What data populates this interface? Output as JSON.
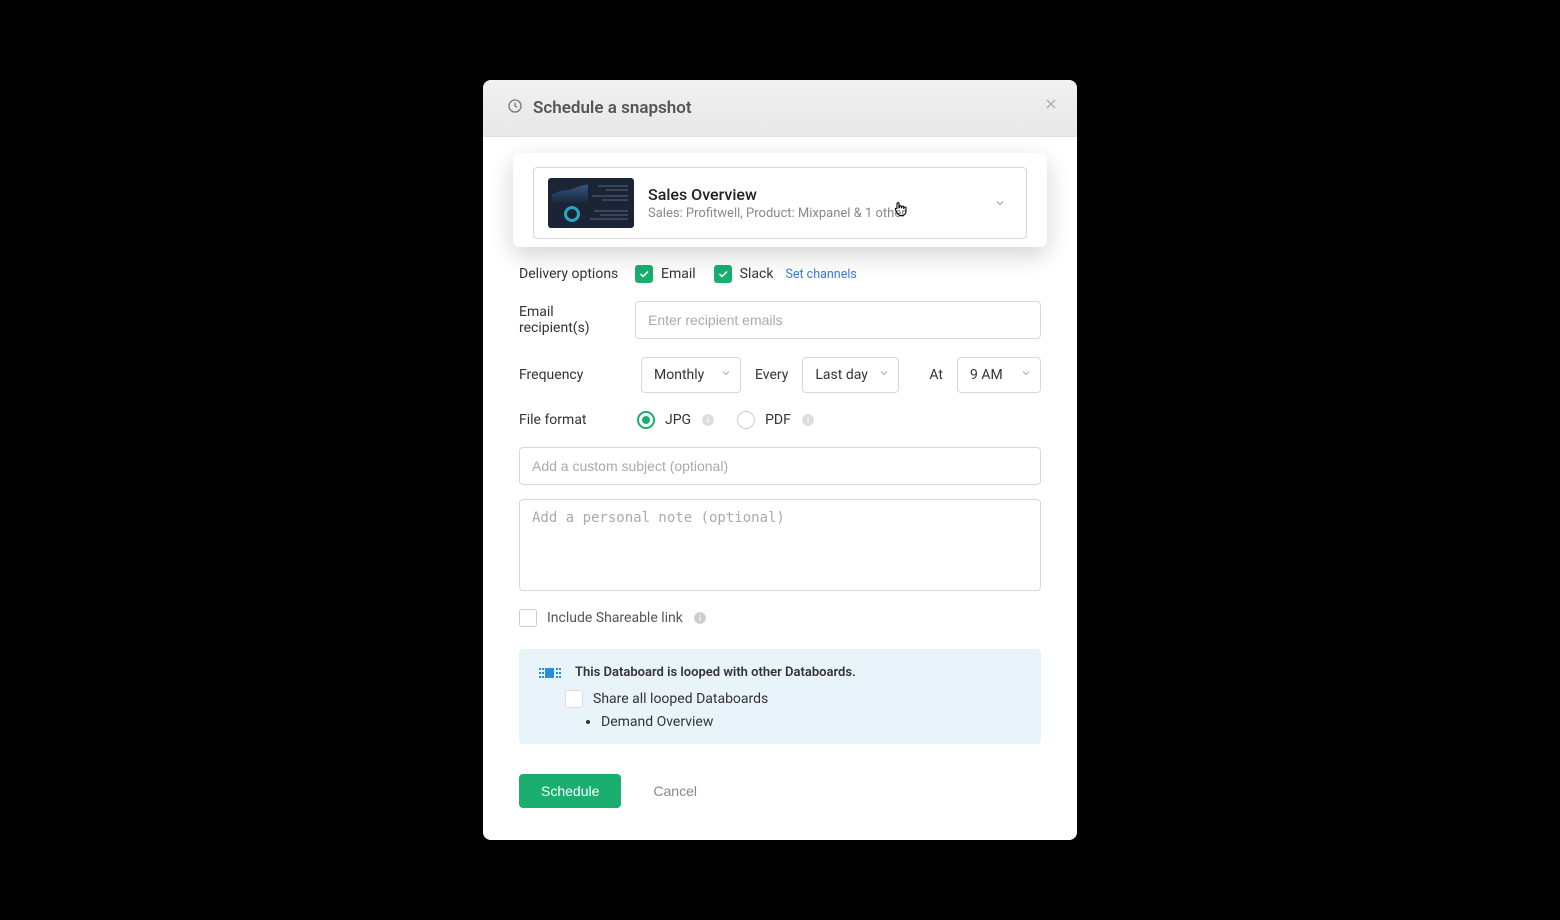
{
  "modal": {
    "title": "Schedule a snapshot"
  },
  "databoard": {
    "title": "Sales Overview",
    "subtitle": "Sales: Profitwell, Product: Mixpanel & 1 other"
  },
  "labels": {
    "delivery_options": "Delivery options",
    "email_recipients": "Email recipient(s)",
    "frequency": "Frequency",
    "file_format": "File format",
    "every": "Every",
    "at": "At"
  },
  "delivery": {
    "email_label": "Email",
    "email_checked": true,
    "slack_label": "Slack",
    "slack_checked": true,
    "set_channels": "Set channels"
  },
  "recipients": {
    "placeholder": "Enter recipient emails"
  },
  "frequency": {
    "period": "Monthly",
    "every": "Last day",
    "at": "9 AM"
  },
  "file_format": {
    "jpg_label": "JPG",
    "pdf_label": "PDF",
    "selected": "jpg"
  },
  "subject": {
    "placeholder": "Add a custom subject (optional)"
  },
  "note": {
    "placeholder": "Add a personal note (optional)"
  },
  "shareable": {
    "label": "Include Shareable link"
  },
  "loop": {
    "heading": "This Databoard is looped with other Databoards.",
    "share_label": "Share all looped Databoards",
    "items": [
      "Demand Overview"
    ]
  },
  "actions": {
    "schedule": "Schedule",
    "cancel": "Cancel"
  }
}
